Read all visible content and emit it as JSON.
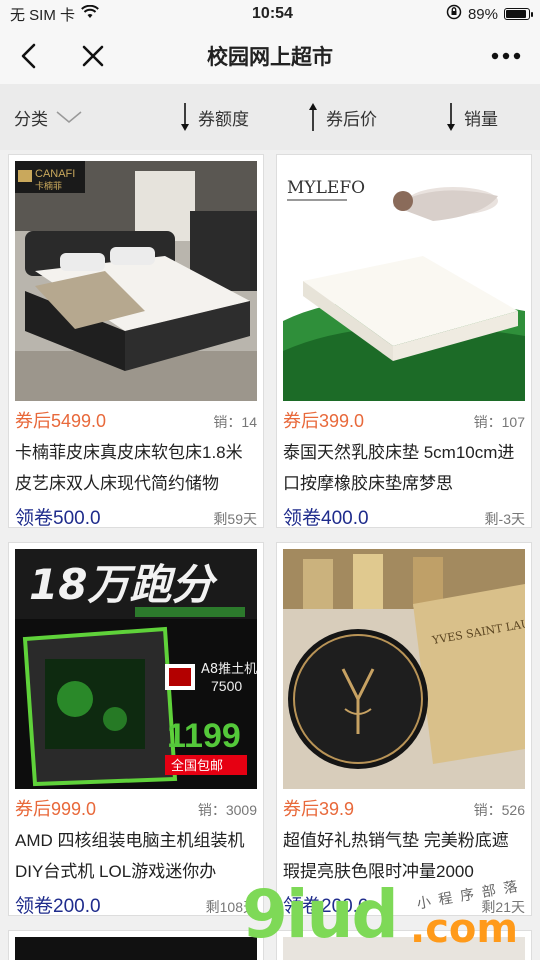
{
  "status_bar": {
    "carrier": "无 SIM 卡",
    "time": "10:54",
    "battery_percent": "89%",
    "battery_level": 0.89,
    "icons": [
      "wifi-icon",
      "rotation-lock-icon",
      "battery-icon"
    ]
  },
  "nav": {
    "title": "校园网上超市",
    "icons": [
      "back-chevron-icon",
      "close-icon",
      "more-dots-icon"
    ]
  },
  "filters": {
    "category": "分类",
    "coupon_amount": "券额度",
    "after_coupon_price": "券后价",
    "sales": "销量"
  },
  "products": [
    {
      "price": "券后5499.0",
      "sold": "销：14",
      "title": "卡楠菲皮床真皮床软包床1.8米皮艺床双人床现代简约储物",
      "coupon": "领卷500.0",
      "remain": "剩59天",
      "image": {
        "brand_text": "CANAFI",
        "brand_sub": "卡楠菲",
        "subject": "leather-bed"
      }
    },
    {
      "price": "券后399.0",
      "sold": "销：107",
      "title": "泰国天然乳胶床垫 5cm10cm进口按摩橡胶床垫席梦思",
      "coupon": "领卷400.0",
      "remain": "剩-3天",
      "image": {
        "brand_text": "MYLEFO",
        "subject": "latex-mattress"
      }
    },
    {
      "price": "券后999.0",
      "sold": "销：3009",
      "title": "AMD 四核组装电脑主机组装机DIY台式机 LOL游戏迷你办",
      "coupon": "领卷200.0",
      "remain": "剩108天",
      "image": {
        "headline": "18万跑分",
        "badge": "A8推土机",
        "model": "7500",
        "price_tag": "1199",
        "shipping": "全国包邮",
        "subject": "gaming-pc"
      }
    },
    {
      "price": "券后39.9",
      "sold": "销：526",
      "title": "超值好礼热销气垫 完美粉底遮瑕提亮肤色限时冲量2000",
      "coupon": "领卷200.0",
      "remain": "剩21天",
      "image": {
        "brand_text": "YVES SAINT LAURENT",
        "subject": "cushion-compact"
      }
    }
  ],
  "watermark": {
    "main": "9iud",
    "dot_com": ".com",
    "small": "小程序部落"
  },
  "colors": {
    "price": "#e8693b",
    "coupon": "#1f2c8c",
    "watermark_green": "#7ed957",
    "watermark_orange": "#ff9a1a"
  }
}
